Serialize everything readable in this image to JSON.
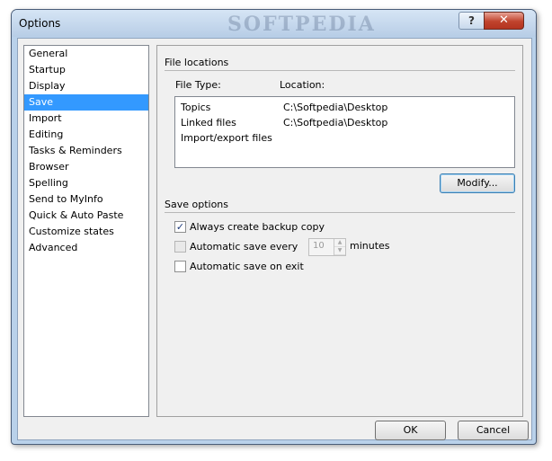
{
  "window": {
    "title": "Options",
    "watermark": "SOFTPEDIA",
    "help_glyph": "?",
    "close_glyph": "✕"
  },
  "nav": {
    "items": [
      {
        "label": "General"
      },
      {
        "label": "Startup"
      },
      {
        "label": "Display"
      },
      {
        "label": "Save",
        "selected": true
      },
      {
        "label": "Import"
      },
      {
        "label": "Editing"
      },
      {
        "label": "Tasks & Reminders"
      },
      {
        "label": "Browser"
      },
      {
        "label": "Spelling"
      },
      {
        "label": "Send to MyInfo"
      },
      {
        "label": "Quick & Auto Paste"
      },
      {
        "label": "Customize states"
      },
      {
        "label": "Advanced"
      }
    ]
  },
  "file_locations": {
    "title": "File locations",
    "col_type": "File Type:",
    "col_location": "Location:",
    "rows": [
      {
        "type": "Topics",
        "path": "C:\\Softpedia\\Desktop"
      },
      {
        "type": "Linked files",
        "path": "C:\\Softpedia\\Desktop"
      },
      {
        "type": "Import/export files",
        "path": ""
      }
    ],
    "modify_label": "Modify..."
  },
  "save_options": {
    "title": "Save options",
    "backup_label": "Always create backup copy",
    "backup_checked": true,
    "autosave_label": "Automatic save every",
    "autosave_checked": false,
    "autosave_value": "10",
    "autosave_unit": "minutes",
    "save_on_exit_label": "Automatic save on exit",
    "save_on_exit_checked": false
  },
  "footer": {
    "ok_label": "OK",
    "cancel_label": "Cancel"
  },
  "colors": {
    "selection": "#3399ff",
    "title_bar": "#b9d1ea",
    "close_button": "#c0432d"
  }
}
